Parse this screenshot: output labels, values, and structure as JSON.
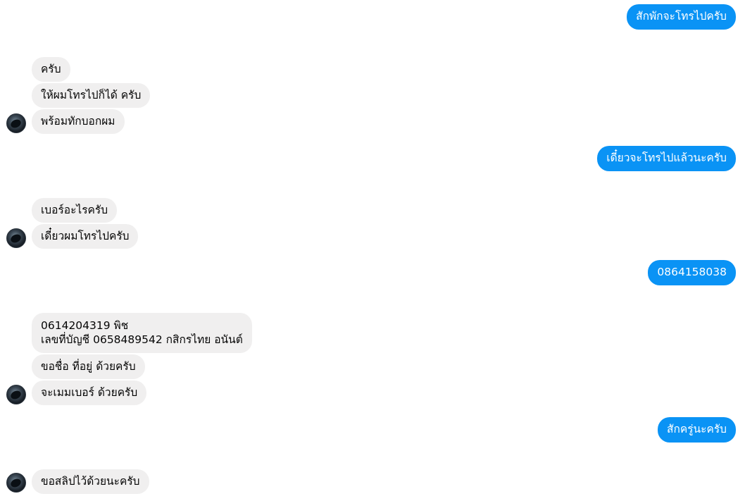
{
  "messages": [
    {
      "side": "out",
      "text": "สักพักจะโทรไปครับ"
    },
    {
      "side": "in",
      "text": "ครับ"
    },
    {
      "side": "in",
      "text": "ให้ผมโทรไปก็ได้ ครับ"
    },
    {
      "side": "in",
      "text": "พร้อมทักบอกผม"
    },
    {
      "side": "out",
      "text": "เดี๋ยวจะโทรไปแล้วนะครับ"
    },
    {
      "side": "in",
      "text": "เบอร์อะไรครับ"
    },
    {
      "side": "in",
      "text": "เดี๋ยวผมโทรไปครับ"
    },
    {
      "side": "out",
      "text": "0864158038"
    },
    {
      "side": "in",
      "line1": "0614204319 พิช",
      "line2": "เลขที่บัญชี 0658489542 กสิกรไทย อนันต์"
    },
    {
      "side": "in",
      "text": "ขอชื่อ ที่อยู่ ด้วยครับ"
    },
    {
      "side": "in",
      "text": "จะเมมเบอร์ ด้วยครับ"
    },
    {
      "side": "out",
      "text": "สักครู่นะครับ"
    },
    {
      "side": "in",
      "text": "ขอสลิปไว้ด้วยนะครับ"
    }
  ],
  "contact_avatar": "avatar-photo-dark-icon"
}
